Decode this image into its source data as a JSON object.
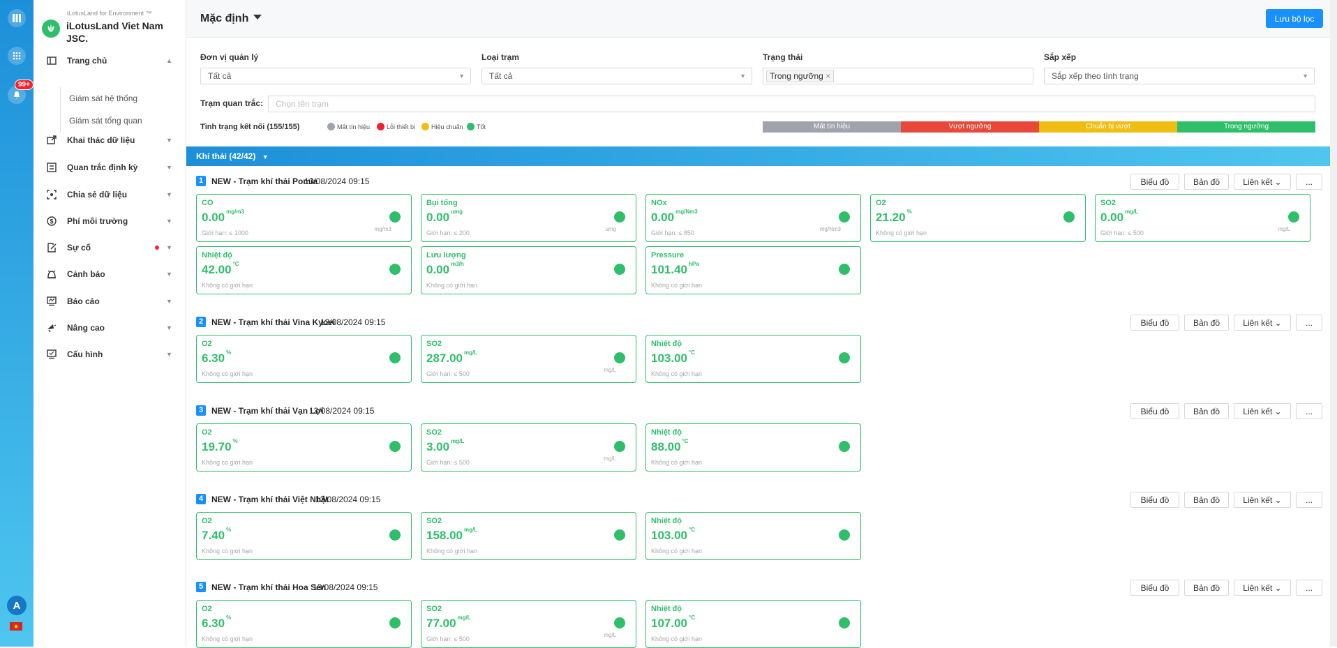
{
  "nav": {
    "badge": "99+",
    "avatar_letter": "A",
    "flag": "★"
  },
  "brand": {
    "small": "iLotusLand for Environment ™",
    "name": "iLotusLand Viet Nam JSC."
  },
  "menu": [
    {
      "label": "Trang chủ",
      "icon": "home-icon",
      "open": true
    },
    {
      "label": "Khai thác dữ liệu",
      "icon": "data-mining-icon"
    },
    {
      "label": "Quan trắc định kỳ",
      "icon": "periodic-icon"
    },
    {
      "label": "Chia sẻ dữ liệu",
      "icon": "share-icon"
    },
    {
      "label": "Phí môi trường",
      "icon": "fee-icon"
    },
    {
      "label": "Sự cố",
      "icon": "incident-icon",
      "dot": true
    },
    {
      "label": "Cảnh báo",
      "icon": "alarm-icon"
    },
    {
      "label": "Báo cáo",
      "icon": "report-icon"
    },
    {
      "label": "Nâng cao",
      "icon": "advanced-icon"
    },
    {
      "label": "Cấu hình",
      "icon": "config-icon"
    }
  ],
  "submenu": [
    "Giám sát hệ thống",
    "Giám sát tổng quan"
  ],
  "header": {
    "title": "Mặc định",
    "save_label": "Lưu bộ lọc"
  },
  "filters": {
    "unit": {
      "label": "Đơn vị quản lý",
      "value": "Tất cả"
    },
    "type": {
      "label": "Loại trạm",
      "value": "Tất cả"
    },
    "status": {
      "label": "Trạng thái",
      "tag": "Trong ngưỡng",
      "tag_close": "×"
    },
    "sort": {
      "label": "Sắp xếp",
      "value": "Sắp xếp theo tình trạng"
    },
    "station": {
      "label": "Trạm quan trắc:",
      "placeholder": "Chọn tên trạm"
    }
  },
  "connection": {
    "label": "Tình trạng kết nối (155/155)",
    "legend": [
      {
        "label": "Mất tín hiệu",
        "color": "#a0a3ab"
      },
      {
        "label": "Lỗi thiết bị",
        "color": "#f5222d"
      },
      {
        "label": "Hiệu chuẩn",
        "color": "#f0bd13"
      },
      {
        "label": "Tốt",
        "color": "#2fbf6b"
      }
    ],
    "bars": [
      {
        "label": "Mất tín hiệu",
        "color": "#a0a3ab"
      },
      {
        "label": "Vượt ngưỡng",
        "color": "#e8483a"
      },
      {
        "label": "Chuẩn bị vượt",
        "color": "#f0bd13"
      },
      {
        "label": "Trong ngưỡng",
        "color": "#2fbf6b"
      }
    ]
  },
  "group": {
    "label": "Khí thải (42/42)"
  },
  "buttons": {
    "chart": "Biểu đồ",
    "map": "Bản đồ",
    "link": "Liên kết",
    "more": "..."
  },
  "stations": [
    {
      "num": "1",
      "name": "NEW - Trạm khí thải Pomia",
      "time": "13/08/2024 09:15",
      "cards": [
        {
          "name": "CO",
          "value": "0.00",
          "unit": "mg/m3",
          "limit": "Giới hạn: ≤ 1000",
          "unit2": "mg/m3"
        },
        {
          "name": "Bụi tổng",
          "value": "0.00",
          "unit": "umg",
          "limit": "Giới hạn: ≤ 200",
          "unit2": "umg"
        },
        {
          "name": "NOx",
          "value": "0.00",
          "unit": "mg/Nm3",
          "limit": "Giới hạn: ≤ 850",
          "unit2": "mg/Nm3"
        },
        {
          "name": "O2",
          "value": "21.20",
          "unit": "%",
          "limit": "Không có giới hạn",
          "unit2": ""
        },
        {
          "name": "SO2",
          "value": "0.00",
          "unit": "mg/L",
          "limit": "Giới hạn: ≤ 500",
          "unit2": "mg/L"
        },
        {
          "name": "Nhiệt độ",
          "value": "42.00",
          "unit": "°C",
          "limit": "Không có giới hạn",
          "unit2": ""
        },
        {
          "name": "Lưu lượng",
          "value": "0.00",
          "unit": "m3/h",
          "limit": "Không có giới hạn",
          "unit2": ""
        },
        {
          "name": "Pressure",
          "value": "101.40",
          "unit": "hPa",
          "limit": "Không có giới hạn",
          "unit2": ""
        }
      ]
    },
    {
      "num": "2",
      "name": "NEW - Trạm khí thải Vina Kyoei",
      "time": "13/08/2024 09:15",
      "cards": [
        {
          "name": "O2",
          "value": "6.30",
          "unit": "%",
          "limit": "Không có giới hạn",
          "unit2": ""
        },
        {
          "name": "SO2",
          "value": "287.00",
          "unit": "mg/L",
          "limit": "Giới hạn: ≤ 500",
          "unit2": "mg/L"
        },
        {
          "name": "Nhiệt độ",
          "value": "103.00",
          "unit": "°C",
          "limit": "Không có giới hạn",
          "unit2": ""
        }
      ]
    },
    {
      "num": "3",
      "name": "NEW - Trạm khí thải Vạn Lợi",
      "time": "13/08/2024 09:15",
      "cards": [
        {
          "name": "O2",
          "value": "19.70",
          "unit": "%",
          "limit": "Không có giới hạn",
          "unit2": ""
        },
        {
          "name": "SO2",
          "value": "3.00",
          "unit": "mg/L",
          "limit": "Giới hạn: ≤ 500",
          "unit2": "mg/L"
        },
        {
          "name": "Nhiệt độ",
          "value": "88.00",
          "unit": "°C",
          "limit": "Không có giới hạn",
          "unit2": ""
        }
      ]
    },
    {
      "num": "4",
      "name": "NEW - Trạm khí thải Việt Nhật",
      "time": "13/08/2024 09:15",
      "cards": [
        {
          "name": "O2",
          "value": "7.40",
          "unit": "%",
          "limit": "Không có giới hạn",
          "unit2": ""
        },
        {
          "name": "SO2",
          "value": "158.00",
          "unit": "mg/L",
          "limit": "Không có giới hạn",
          "unit2": ""
        },
        {
          "name": "Nhiệt độ",
          "value": "103.00",
          "unit": "°C",
          "limit": "Không có giới hạn",
          "unit2": ""
        }
      ]
    },
    {
      "num": "5",
      "name": "NEW - Trạm khí thải Hoa Sen",
      "time": "13/08/2024 09:15",
      "cards": [
        {
          "name": "O2",
          "value": "6.30",
          "unit": "%",
          "limit": "Không có giới hạn",
          "unit2": ""
        },
        {
          "name": "SO2",
          "value": "77.00",
          "unit": "mg/L",
          "limit": "Giới hạn: ≤ 500",
          "unit2": "mg/L"
        },
        {
          "name": "Nhiệt độ",
          "value": "107.00",
          "unit": "°C",
          "limit": "Không có giới hạn",
          "unit2": ""
        }
      ]
    }
  ]
}
